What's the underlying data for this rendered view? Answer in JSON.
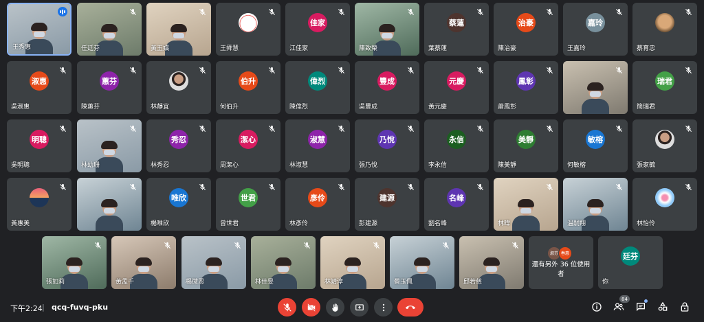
{
  "colors": {
    "background": "#202124",
    "tile": "#3c4043",
    "speaking_border": "#8ab4f8",
    "end_call": "#ea4335"
  },
  "tiles": [
    {
      "name": "王秀惠",
      "type": "video",
      "speaking": true
    },
    {
      "name": "任廷芬",
      "type": "video"
    },
    {
      "name": "黃玉嬌",
      "type": "video"
    },
    {
      "name": "王舜慧",
      "type": "pic",
      "pic": "hello-kitty-avatar"
    },
    {
      "name": "江佳家",
      "type": "avatar",
      "initial": "佳家",
      "color": "#d81b60"
    },
    {
      "name": "陳致榮",
      "type": "video"
    },
    {
      "name": "葉蔡蓮",
      "type": "avatar",
      "initial": "蔡蓮",
      "color": "#4e342e"
    },
    {
      "name": "陳治豪",
      "type": "avatar",
      "initial": "治豪",
      "color": "#e64a19"
    },
    {
      "name": "王嘉玲",
      "type": "avatar",
      "initial": "嘉玲",
      "color": "#78909c"
    },
    {
      "name": "蔡育忠",
      "type": "pic",
      "pic": "dog-avatar"
    },
    {
      "name": "吳淑惠",
      "type": "avatar",
      "initial": "淑惠",
      "color": "#e64a19"
    },
    {
      "name": "陳蕙芬",
      "type": "avatar",
      "initial": "蕙芬",
      "color": "#8e24aa"
    },
    {
      "name": "林靜宜",
      "type": "pic",
      "pic": "person-avatar"
    },
    {
      "name": "何伯升",
      "type": "avatar",
      "initial": "伯升",
      "color": "#e64a19"
    },
    {
      "name": "陳偉烈",
      "type": "avatar",
      "initial": "偉烈",
      "color": "#00897b"
    },
    {
      "name": "吳豐成",
      "type": "avatar",
      "initial": "豐成",
      "color": "#d81b60"
    },
    {
      "name": "黃元慶",
      "type": "avatar",
      "initial": "元慶",
      "color": "#d81b60"
    },
    {
      "name": "蕭鳳彰",
      "type": "avatar",
      "initial": "鳳彰",
      "color": "#5e35b1"
    },
    {
      "name": "",
      "type": "video"
    },
    {
      "name": "簡瑞君",
      "type": "avatar",
      "initial": "瑞君",
      "color": "#43a047"
    },
    {
      "name": "吳明聰",
      "type": "avatar",
      "initial": "明聰",
      "color": "#d81b60"
    },
    {
      "name": "林幼珊",
      "type": "video"
    },
    {
      "name": "林秀忍",
      "type": "avatar",
      "initial": "秀忍",
      "color": "#8e24aa"
    },
    {
      "name": "周潔心",
      "type": "avatar",
      "initial": "潔心",
      "color": "#d81b60"
    },
    {
      "name": "林淑慧",
      "type": "avatar",
      "initial": "淑慧",
      "color": "#8e24aa"
    },
    {
      "name": "張乃悅",
      "type": "avatar",
      "initial": "乃悅",
      "color": "#5e35b1"
    },
    {
      "name": "李永信",
      "type": "avatar",
      "initial": "永信",
      "color": "#1b5e20"
    },
    {
      "name": "陳美靜",
      "type": "avatar",
      "initial": "美靜",
      "color": "#2e7d32"
    },
    {
      "name": "何敏榕",
      "type": "avatar",
      "initial": "敏榕",
      "color": "#1976d2"
    },
    {
      "name": "張家毓",
      "type": "pic",
      "pic": "person-avatar"
    },
    {
      "name": "黃惠美",
      "type": "pic",
      "pic": "sunset-avatar"
    },
    {
      "name": "",
      "type": "video"
    },
    {
      "name": "楊唯欣",
      "type": "avatar",
      "initial": "唯欣",
      "color": "#1976d2"
    },
    {
      "name": "曾世君",
      "type": "avatar",
      "initial": "世君",
      "color": "#43a047"
    },
    {
      "name": "林彥伶",
      "type": "avatar",
      "initial": "彥伶",
      "color": "#e64a19"
    },
    {
      "name": "彭建源",
      "type": "avatar",
      "initial": "建源",
      "color": "#4e342e"
    },
    {
      "name": "劉名峰",
      "type": "avatar",
      "initial": "名峰",
      "color": "#5e35b1"
    },
    {
      "name": "林暐",
      "type": "video"
    },
    {
      "name": "溫嗣翔",
      "type": "video"
    },
    {
      "name": "林怡伶",
      "type": "pic",
      "pic": "flower-avatar"
    },
    {
      "name": "張如莉",
      "type": "video"
    },
    {
      "name": "黃孟千",
      "type": "video"
    },
    {
      "name": "楊微恩",
      "type": "video"
    },
    {
      "name": "林佳旻",
      "type": "video"
    },
    {
      "name": "林靖淳",
      "type": "video"
    },
    {
      "name": "蔡玉佩",
      "type": "video"
    },
    {
      "name": "邱若慈",
      "type": "video"
    },
    {
      "name": "",
      "type": "others"
    },
    {
      "name": "你",
      "type": "avatar",
      "initial": "廷芬",
      "color": "#00897b"
    }
  ],
  "others": {
    "label": "還有另外 36 位使用者",
    "chips": [
      {
        "text": "淑芬",
        "color": "#795548"
      },
      {
        "text": "春惠",
        "color": "#e64a19"
      }
    ]
  },
  "bottombar": {
    "time": "下午2:24",
    "separator": "|",
    "meeting_code": "qcq-fuvq-pku",
    "people_count": "84"
  },
  "icons": {
    "mic_off": "mic-off-icon",
    "cam_off": "camera-off-icon",
    "hand": "raise-hand-icon",
    "present": "present-screen-icon",
    "more": "more-vert-icon",
    "end": "end-call-icon",
    "info": "info-icon",
    "people": "people-icon",
    "chat": "chat-icon",
    "activities": "activities-icon",
    "lock": "host-controls-icon"
  }
}
